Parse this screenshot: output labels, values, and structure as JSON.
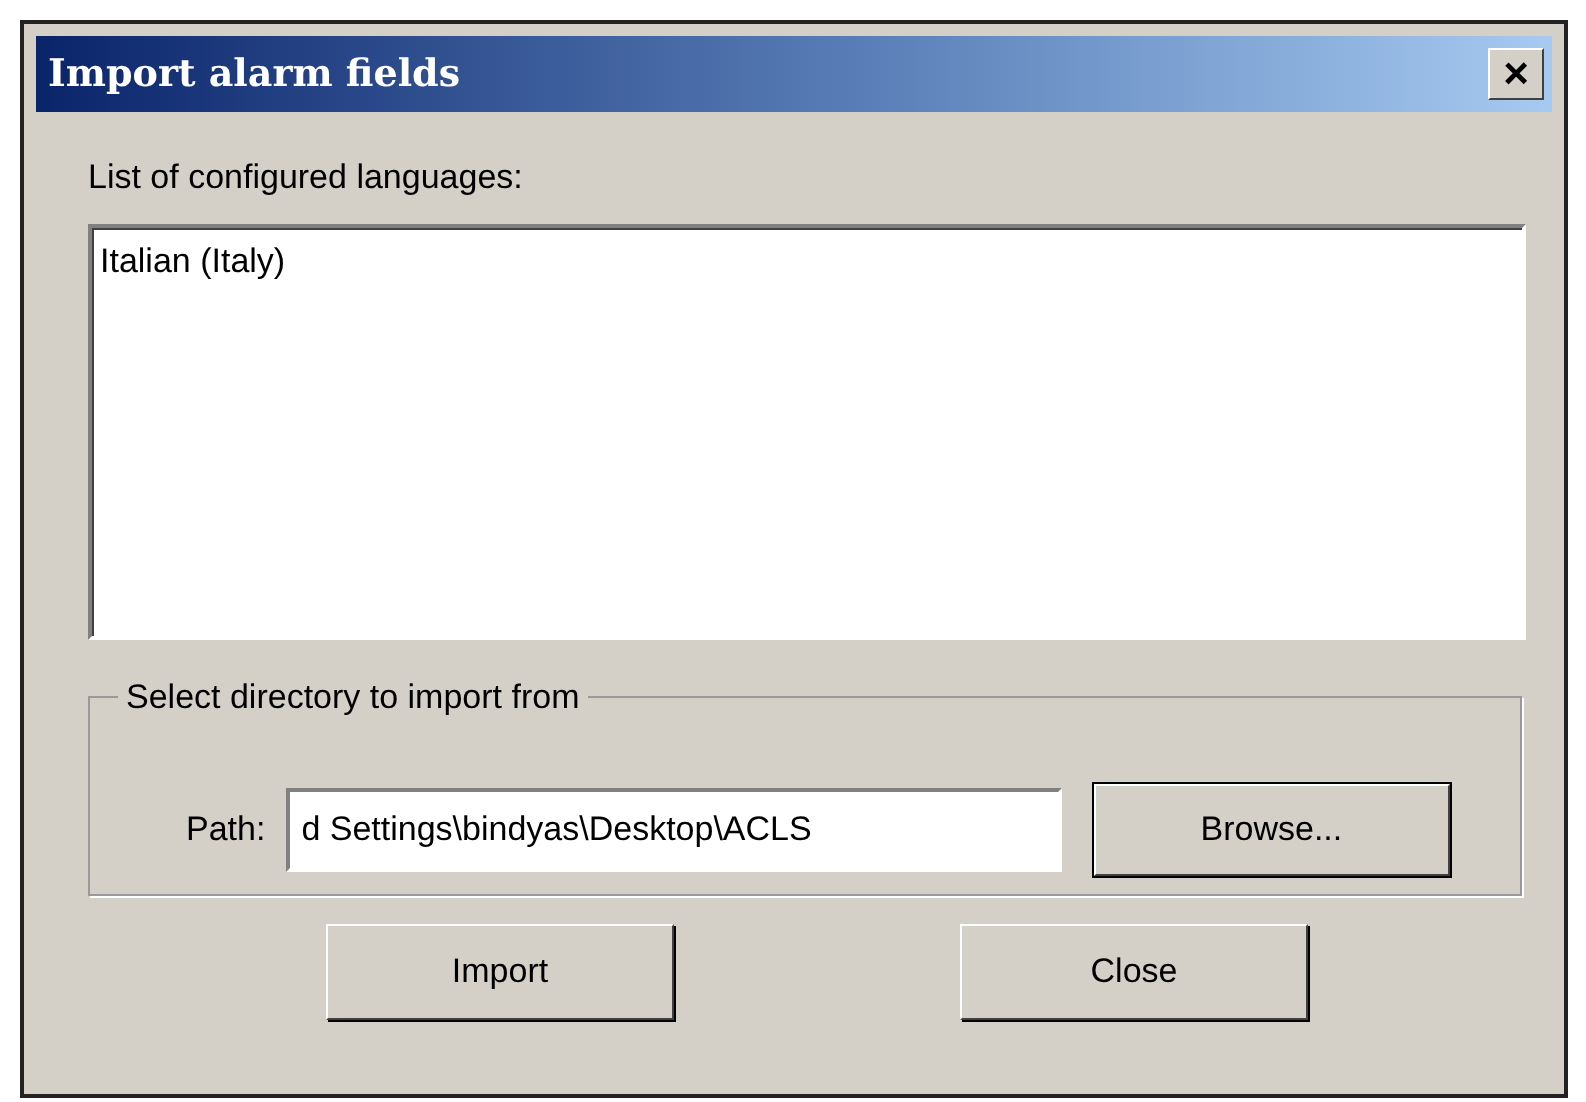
{
  "window": {
    "title": "Import alarm fields",
    "close_glyph": "×"
  },
  "languages": {
    "label": "List of configured languages:",
    "items": [
      "Italian (Italy)"
    ]
  },
  "directory_group": {
    "legend": "Select directory to import from",
    "path_label": "Path:",
    "path_value": "d Settings\\bindyas\\Desktop\\ACLS",
    "browse_button": "Browse..."
  },
  "buttons": [
    "Import",
    "Close"
  ]
}
